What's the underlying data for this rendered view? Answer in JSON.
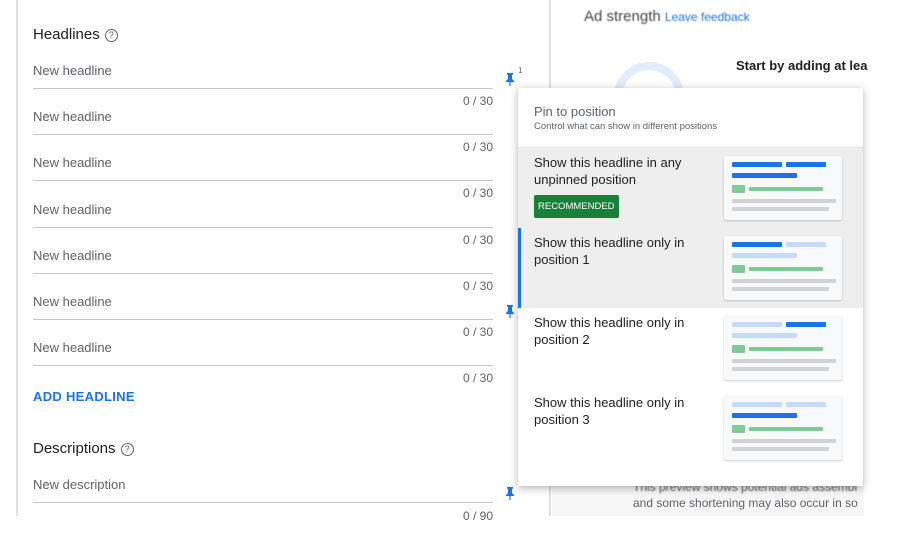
{
  "headlines": {
    "title": "Headlines",
    "help": "?",
    "placeholder": "New headline",
    "counters": [
      "0 / 30",
      "0 / 30",
      "0 / 30",
      "0 / 30",
      "0 / 30",
      "0 / 30",
      "0 / 30"
    ],
    "pin_badge": "1",
    "add_label": "ADD HEADLINE"
  },
  "descriptions": {
    "title": "Descriptions",
    "help": "?",
    "placeholder": "New description",
    "counter": "0 / 90"
  },
  "ad_strength": {
    "title": "Ad strength",
    "feedback": "Leave feedback",
    "prompt": "Start by adding at lea",
    "preview_note_1": "This preview shows potential ads assembl",
    "preview_note_2": "and some shortening may also occur in so"
  },
  "popup": {
    "title": "Pin to position",
    "subtitle": "Control what can show in different positions",
    "options": [
      {
        "label": "Show this headline in any unpinned position",
        "badge": "RECOMMENDED",
        "highlight": [
          1,
          1,
          1
        ]
      },
      {
        "label": "Show this headline only in position 1",
        "highlight": [
          1,
          0,
          0
        ]
      },
      {
        "label": "Show this headline only in position 2",
        "highlight": [
          0,
          1,
          0
        ]
      },
      {
        "label": "Show this headline only in position 3",
        "highlight": [
          0,
          0,
          1
        ]
      }
    ],
    "selected_index": 1
  },
  "colors": {
    "accent": "#1a73e8",
    "recommended": "#188038"
  },
  "icons": {
    "pin": "pin-icon",
    "help": "help-circle-icon"
  }
}
